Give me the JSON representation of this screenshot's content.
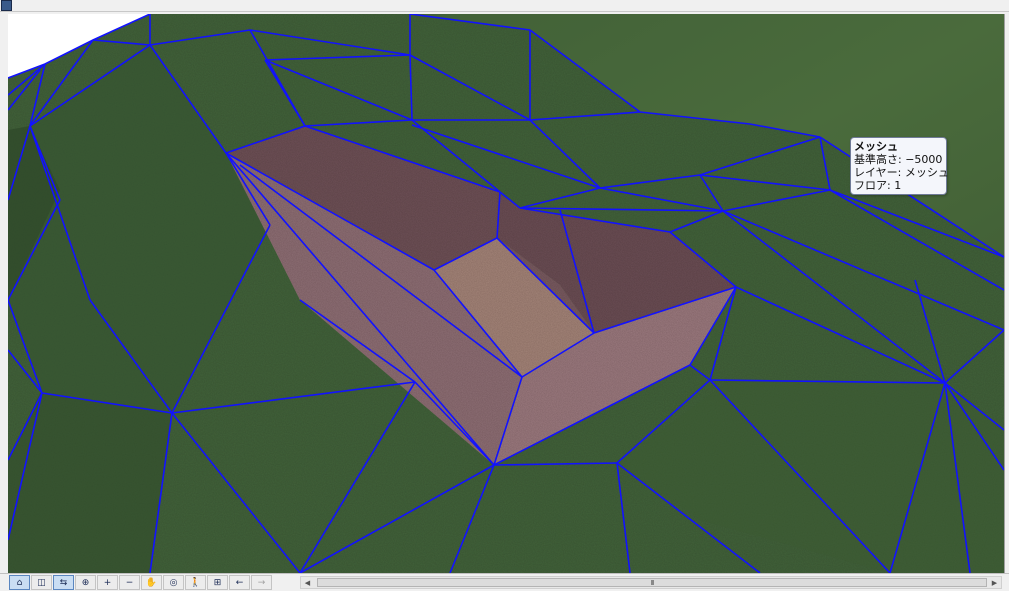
{
  "tooltip": {
    "title": "メッシュ",
    "base_height": "基準高さ: −5000",
    "layer": "レイヤー: メッシュ",
    "floor": "フロア: 1"
  },
  "toolbar": {
    "buttons": [
      {
        "name": "home-view-icon",
        "glyph": "⌂"
      },
      {
        "name": "zoom-window-icon",
        "glyph": "◫"
      },
      {
        "name": "previous-view-icon",
        "glyph": "⇆"
      },
      {
        "name": "zoom-in-out-icon",
        "glyph": "⊕"
      },
      {
        "name": "zoom-in-icon",
        "glyph": "+"
      },
      {
        "name": "zoom-out-icon",
        "glyph": "−"
      },
      {
        "name": "pan-hand-icon",
        "glyph": "✋"
      },
      {
        "name": "orbit-icon",
        "glyph": "◎"
      },
      {
        "name": "walk-icon",
        "glyph": "🚶"
      },
      {
        "name": "fit-in-window-icon",
        "glyph": "⊞"
      },
      {
        "name": "zoom-back-icon",
        "glyph": "←"
      },
      {
        "name": "zoom-forward-icon",
        "glyph": "→"
      }
    ]
  },
  "scrollbar": {
    "thumb_grip": "III"
  },
  "colors": {
    "terrain_green": "#3f5c33",
    "mesh_edge": "#1010ff",
    "excavation_wall": "#8e6f73",
    "excavation_floor": "#a88678"
  }
}
